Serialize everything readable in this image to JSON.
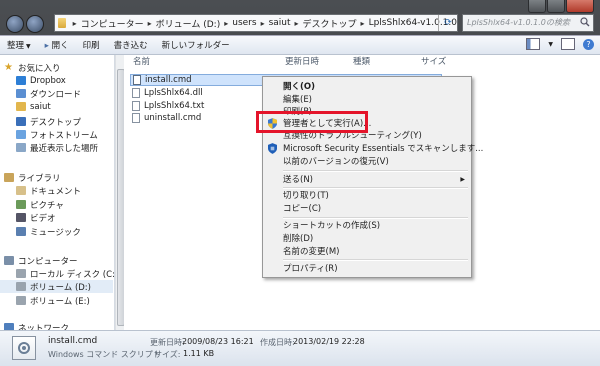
{
  "address": {
    "parts": [
      "コンピューター",
      "ボリューム (D:)",
      "users",
      "saiut",
      "デスクトップ",
      "LplsShlx64-v1.0.1.0"
    ]
  },
  "search": {
    "placeholder": "LplsShlx64-v1.0.1.0の検索"
  },
  "toolbar": {
    "organize": "整理",
    "open": "開く",
    "print": "印刷",
    "burn": "書き込む",
    "new_folder": "新しいフォルダー"
  },
  "sidebar": {
    "favorites": "お気に入り",
    "dropbox": "Dropbox",
    "downloads": "ダウンロード",
    "saiut": "saiut",
    "desktop": "デスクトップ",
    "photostream": "フォトストリーム",
    "recent": "最近表示した場所",
    "libraries": "ライブラリ",
    "documents": "ドキュメント",
    "pictures": "ピクチャ",
    "videos": "ビデオ",
    "music": "ミュージック",
    "computer": "コンピューター",
    "local_disk": "ローカル ディスク (C:)",
    "volume_d": "ボリューム (D:)",
    "volume_e": "ボリューム (E:)",
    "network": "ネットワーク"
  },
  "columns": {
    "name": "名前",
    "modified": "更新日時",
    "type": "種類",
    "size": "サイズ"
  },
  "files": [
    "install.cmd",
    "LplsShlx64.dll",
    "LplsShlx64.txt",
    "uninstall.cmd"
  ],
  "menu": {
    "open": "開く(O)",
    "edit": "編集(E)",
    "print": "印刷(P)",
    "run_as_admin": "管理者として実行(A)...",
    "troubleshoot": "互換性のトラブルシューティング(Y)",
    "mse_scan": "Microsoft Security Essentials でスキャンします...",
    "restore": "以前のバージョンの復元(V)",
    "send_to": "送る(N)",
    "cut": "切り取り(T)",
    "copy": "コピー(C)",
    "create_shortcut": "ショートカットの作成(S)",
    "delete": "削除(D)",
    "rename": "名前の変更(M)",
    "properties": "プロパティ(R)"
  },
  "details": {
    "filename": "install.cmd",
    "filetype": "Windows コマンド スクリプト",
    "modified_label": "更新日時:",
    "modified_value": "2009/08/23 16:21",
    "created_label": "作成日時:",
    "created_value": "2013/02/19 22:28",
    "size_label": "サイズ:",
    "size_value": "1.11 KB"
  },
  "colors": {
    "highlight": "#e4142a",
    "selection": "#cfe3fc"
  }
}
